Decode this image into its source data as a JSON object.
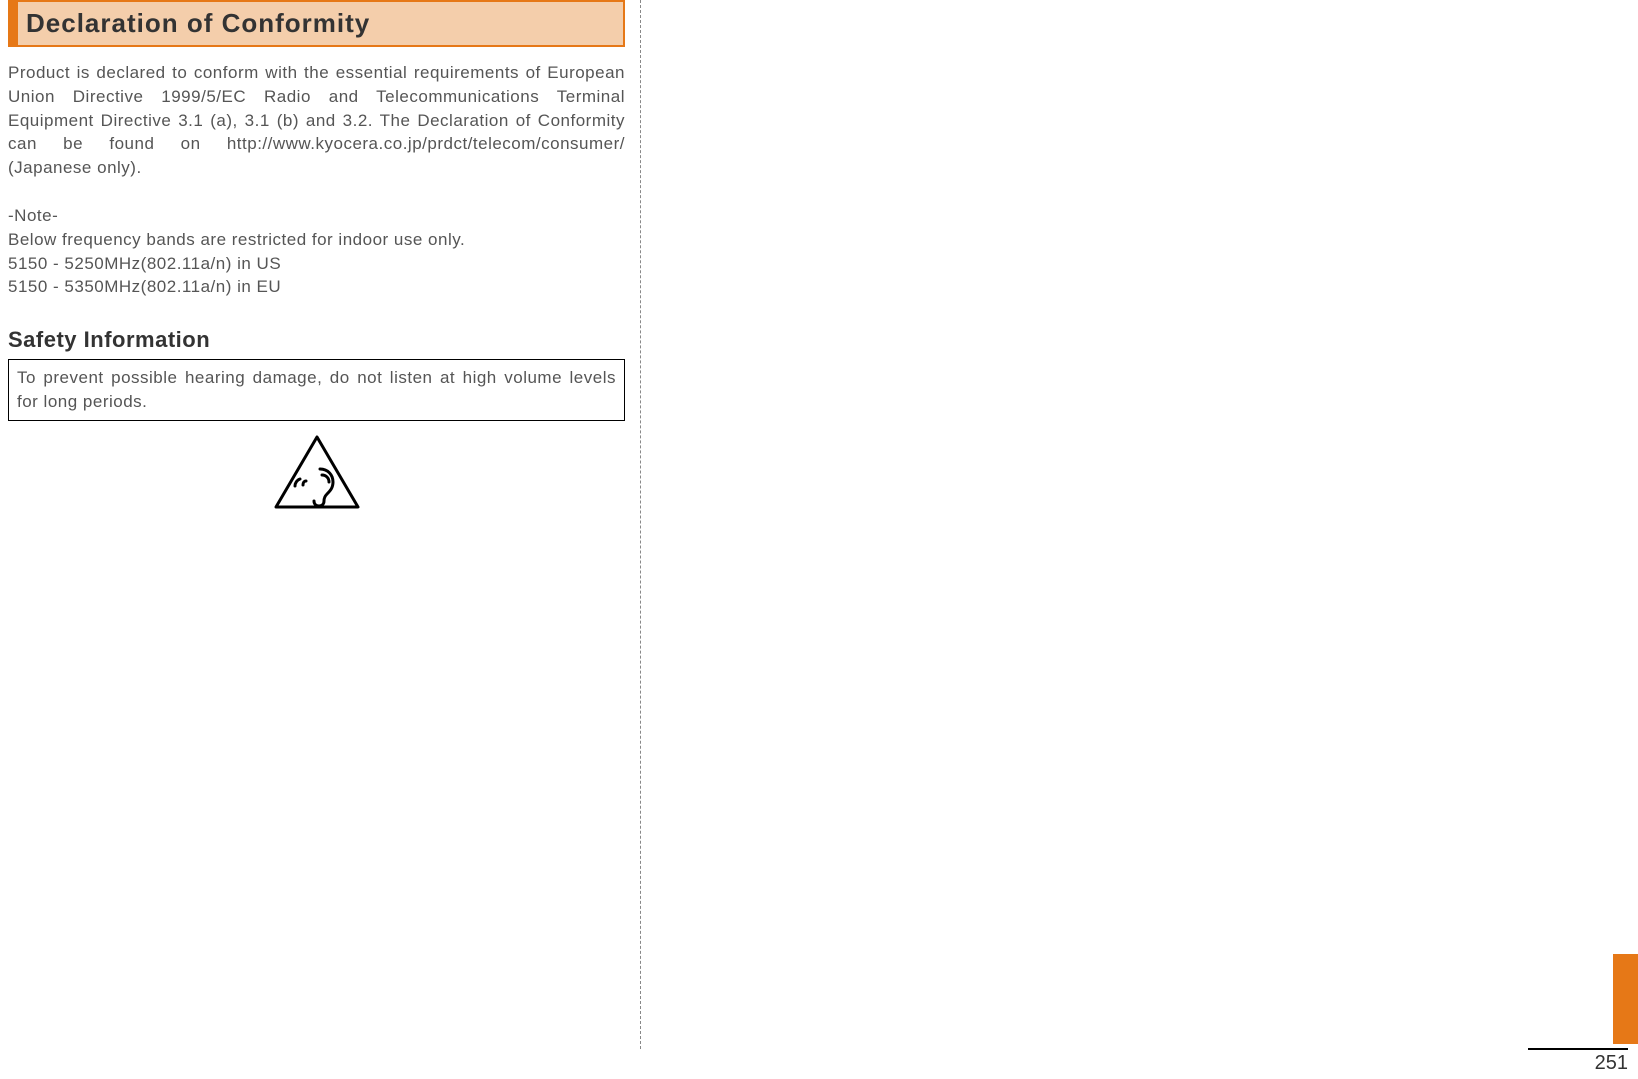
{
  "section_header": "Declaration of Conformity",
  "paragraph": "Product is declared to conform with the essential requirements of European Union Directive 1999/5/EC Radio and Telecommunications Terminal Equipment Directive 3.1 (a), 3.1 (b) and 3.2. The Declaration of Conformity can be found on http://www.kyocera.co.jp/prdct/telecom/consumer/　(Japanese only).",
  "note": {
    "label": "-Note-",
    "lines": [
      "Below frequency bands are restricted for indoor use only.",
      "5150 - 5250MHz(802.11a/n) in US",
      "5150 - 5350MHz(802.11a/n) in EU"
    ]
  },
  "safety": {
    "heading": "Safety Information",
    "box_text": "To prevent possible hearing damage, do not listen at high volume levels for long periods."
  },
  "page_number": "251"
}
